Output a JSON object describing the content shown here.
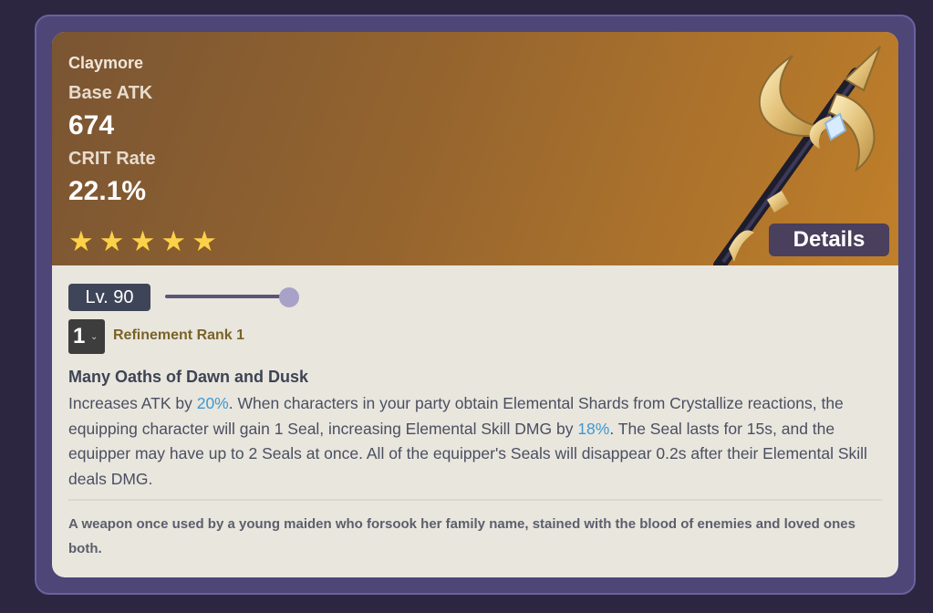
{
  "weapon": {
    "type": "Claymore",
    "stat1_label": "Base ATK",
    "stat1_value": "674",
    "stat2_label": "CRIT Rate",
    "stat2_value": "22.1%",
    "rarity": 5,
    "details_label": "Details"
  },
  "level": {
    "label": "Lv. 90",
    "slider_fraction": 1.0
  },
  "refinement": {
    "selected": "1",
    "label": "Refinement Rank 1"
  },
  "passive": {
    "name": "Many Oaths of Dawn and Dusk",
    "desc_1": "Increases ATK by ",
    "desc_hl1": "20%",
    "desc_2": ". When characters in your party obtain Elemental Shards from Crystallize reactions, the equipping character will gain 1 Seal, increasing Elemental Skill DMG by ",
    "desc_hl2": "18%",
    "desc_3": ". The Seal lasts for 15s, and the equipper may have up to 2 Seals at once. All of the equipper's Seals will disappear 0.2s after their Elemental Skill deals DMG."
  },
  "lore": "A weapon once used by a young maiden who forsook her family name, stained with the blood of enemies and loved ones both.",
  "colors": {
    "frame": "#4d4677",
    "header_start": "#7a5533",
    "header_end": "#c07f2a",
    "star": "#fbd14a",
    "highlight": "#3d98d3",
    "refinement_text": "#7a6328"
  },
  "icons": [
    "star-icon",
    "chevron-down-icon",
    "weapon-image"
  ]
}
